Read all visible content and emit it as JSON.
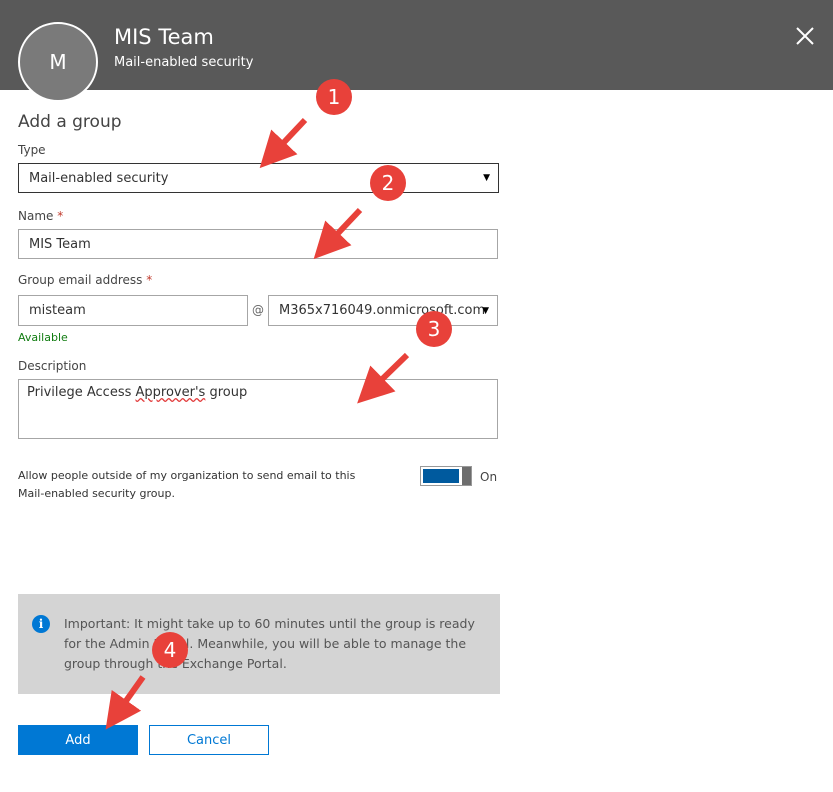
{
  "header": {
    "avatar_initial": "M",
    "title": "MIS Team",
    "subtitle": "Mail-enabled security",
    "close_icon": "close-icon"
  },
  "form": {
    "section_title": "Add a group",
    "type": {
      "label": "Type",
      "value": "Mail-enabled security"
    },
    "name": {
      "label": "Name",
      "required_mark": "*",
      "value": "MIS Team"
    },
    "email": {
      "label": "Group email address",
      "required_mark": "*",
      "alias": "misteam",
      "at": "@",
      "domain": "M365x716049.onmicrosoft.com",
      "status": "Available"
    },
    "description": {
      "label": "Description",
      "value_before": "Privilege Access ",
      "value_misspelled": "Approver's",
      "value_after": " group"
    },
    "external": {
      "text": "Allow people outside of my organization to send email to this Mail-enabled security group.",
      "toggle_state": "On"
    }
  },
  "info": {
    "icon": "info-icon",
    "text": "Important: It might take up to 60 minutes until the group is ready for the Admin Portal. Meanwhile, you will be able to manage the group through the Exchange Portal."
  },
  "buttons": {
    "add": "Add",
    "cancel": "Cancel"
  },
  "annotations": {
    "color": "#e8413a",
    "badges": [
      "1",
      "2",
      "3",
      "4"
    ]
  },
  "colors": {
    "header_bg": "#595959",
    "accent": "#0078d4",
    "available": "#107c10",
    "info_bg": "#d4d4d4"
  }
}
